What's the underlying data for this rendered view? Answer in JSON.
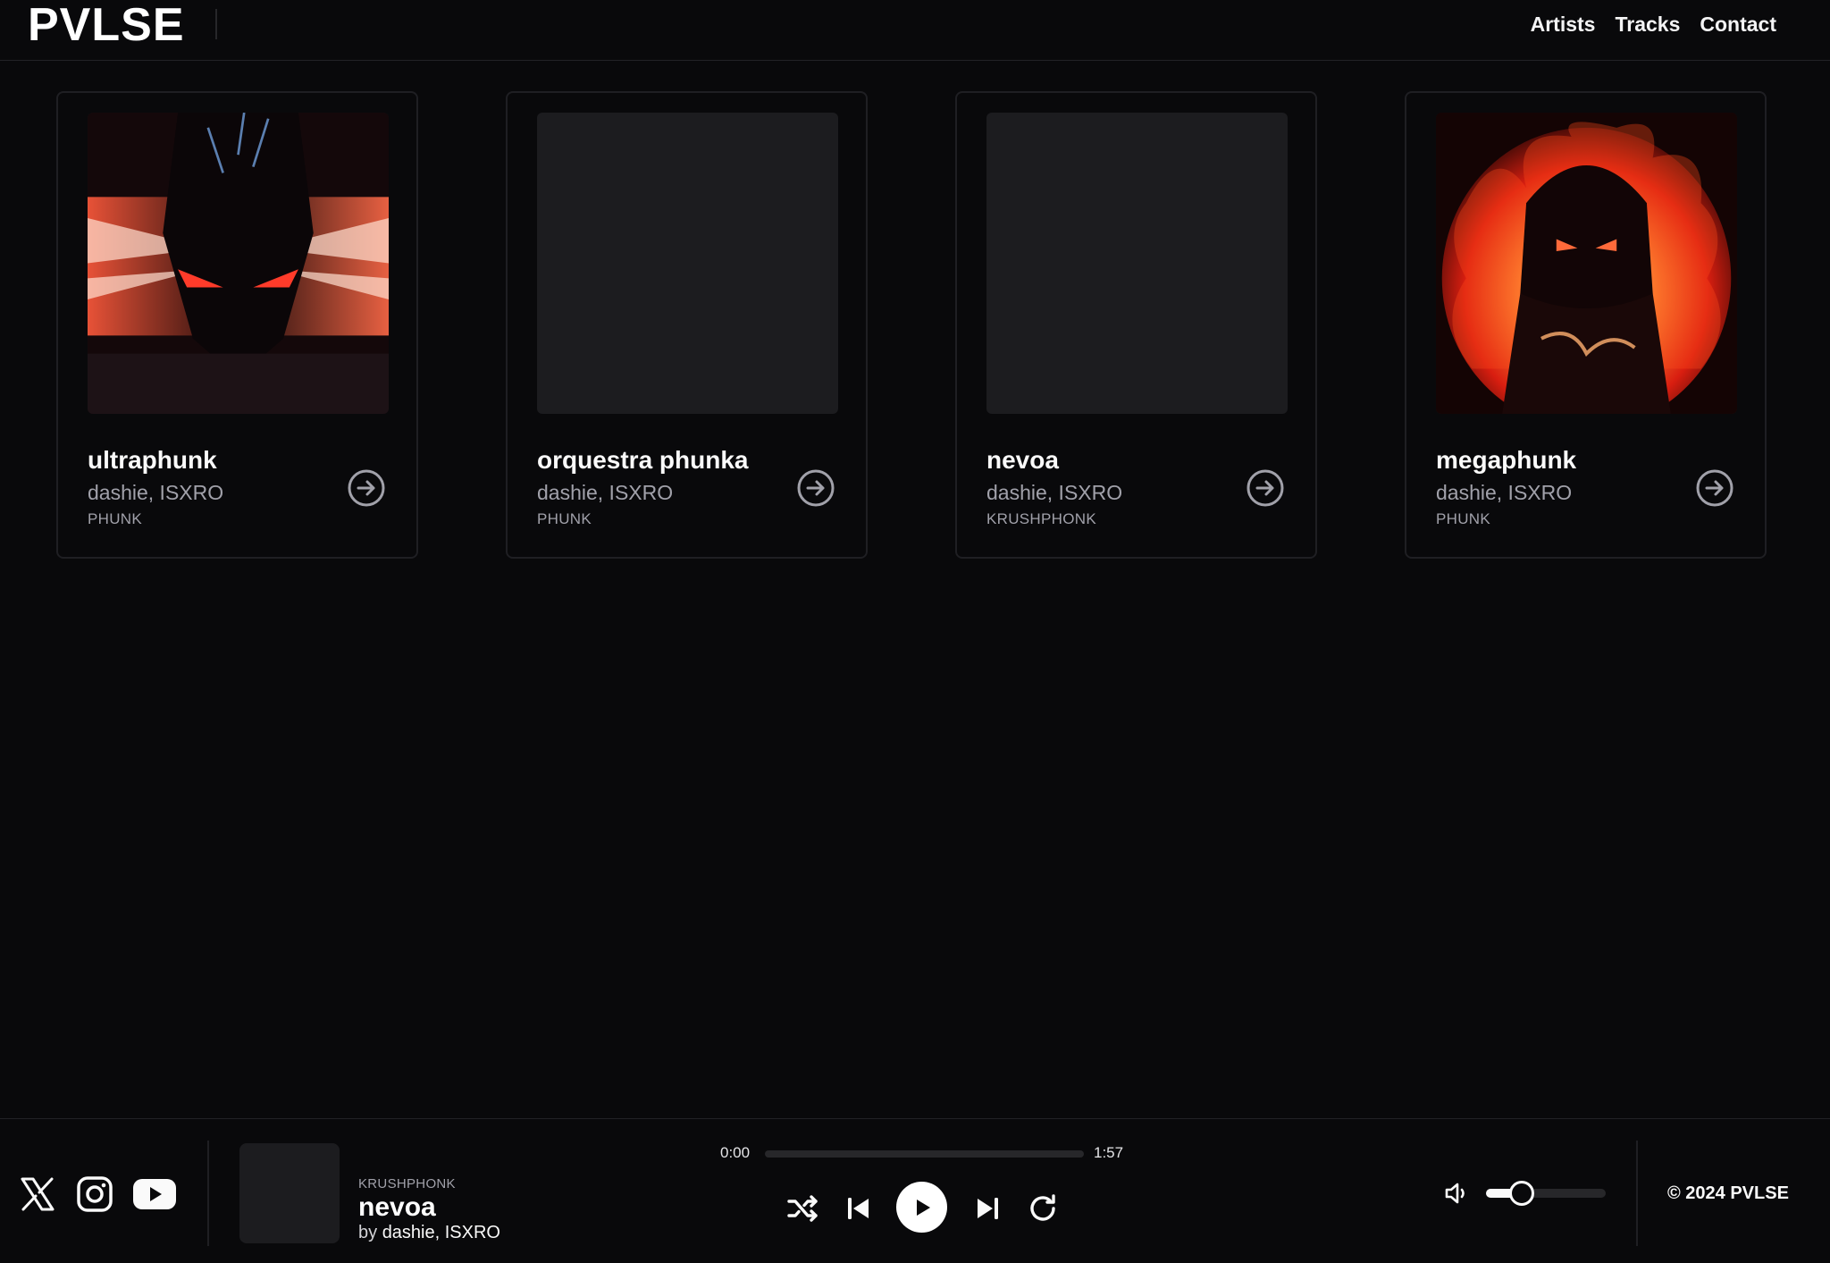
{
  "brand": {
    "logo": "PVLSE"
  },
  "nav": {
    "items": [
      "Artists",
      "Tracks",
      "Contact"
    ]
  },
  "tracks": [
    {
      "title": "ultraphunk",
      "artists": "dashie, ISXRO",
      "genre": "PHUNK",
      "cover": "demon-red-art"
    },
    {
      "title": "orquestra phunka",
      "artists": "dashie, ISXRO",
      "genre": "PHUNK",
      "cover": "none"
    },
    {
      "title": "nevoa",
      "artists": "dashie, ISXRO",
      "genre": "KRUSHPHONK",
      "cover": "none"
    },
    {
      "title": "megaphunk",
      "artists": "dashie, ISXRO",
      "genre": "PHUNK",
      "cover": "fire-figure-art"
    }
  ],
  "player": {
    "now_playing": {
      "genre": "KRUSHPHONK",
      "title": "nevoa",
      "by_label": "by",
      "artists": "dashie, ISXRO"
    },
    "current_time": "0:00",
    "duration": "1:57",
    "progress_fraction": 0,
    "volume_fraction": 0.3,
    "controls": [
      "shuffle-icon",
      "skip-back-icon",
      "play-icon",
      "skip-forward-icon",
      "repeat-icon"
    ]
  },
  "social": [
    "x-icon",
    "instagram-icon",
    "youtube-icon"
  ],
  "footer": {
    "copyright": "© 2024 PVLSE"
  },
  "colors": {
    "background": "#09090b",
    "card_border": "#1f1f23",
    "text_muted": "#a1a1aa",
    "accent": "#ffffff"
  }
}
